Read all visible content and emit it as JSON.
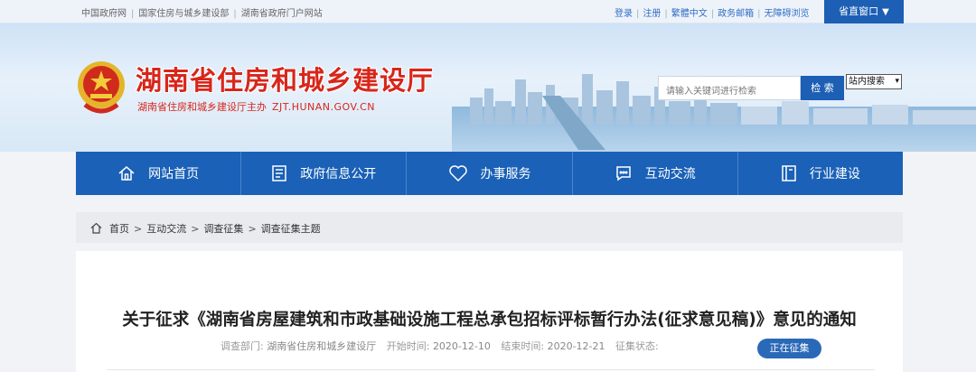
{
  "topbar": {
    "left_links": [
      "中国政府网",
      "国家住房与城乡建设部",
      "湖南省政府门户网站"
    ],
    "right_links": [
      "登录",
      "注册",
      "繁體中文",
      "政务邮箱",
      "无障碍浏览"
    ],
    "portal": "省直窗口"
  },
  "header": {
    "title": "湖南省住房和城乡建设厅",
    "sponsor": "湖南省住房和城乡建设厅主办",
    "domain": "ZJT.HUNAN.GOV.CN",
    "search_placeholder": "请输入关键词进行检索",
    "search_button": "检 索",
    "scope_selected": "站内搜索"
  },
  "nav": [
    {
      "label": "网站首页",
      "icon": "home-icon"
    },
    {
      "label": "政府信息公开",
      "icon": "document-icon"
    },
    {
      "label": "办事服务",
      "icon": "heart-icon"
    },
    {
      "label": "互动交流",
      "icon": "chat-icon"
    },
    {
      "label": "行业建设",
      "icon": "book-icon"
    }
  ],
  "breadcrumb": [
    "首页",
    "互动交流",
    "调查征集",
    "调查征集主题"
  ],
  "article": {
    "title": "关于征求《湖南省房屋建筑和市政基础设施工程总承包招标评标暂行办法(征求意见稿)》意见的通知",
    "dept_label": "调查部门:",
    "dept_value": "湖南省住房和城乡建设厅",
    "start_label": "开始时间:",
    "start_value": "2020-12-10",
    "end_label": "结束时间:",
    "end_value": "2020-12-21",
    "status_label": "征集状态:",
    "status_value": "正在征集"
  },
  "colors": {
    "brand_red": "#d8261b",
    "nav_blue": "#1a61b7",
    "status_blue": "#2a69b8"
  }
}
